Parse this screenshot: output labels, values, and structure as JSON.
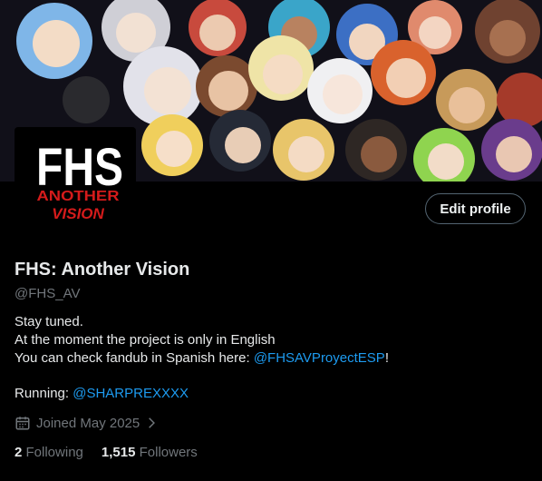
{
  "profile": {
    "avatar_text_main": "FHS",
    "avatar_text_sub1": "ANOTHER",
    "avatar_text_sub2": "VISION",
    "edit_button": "Edit profile",
    "display_name": "FHS: Another Vision",
    "handle": "@FHS_AV",
    "bio": {
      "line1": "Stay tuned.",
      "line2": "At the moment the project is only in English",
      "line3_prefix": "You can check fandub in Spanish here: ",
      "line3_link": "@FHSAVProyectESP",
      "line3_suffix": "!"
    },
    "running_label": "Running: ",
    "running_link": "@SHARPREXXXX",
    "joined": "Joined May 2025",
    "following_count": "2",
    "following_label": "Following",
    "followers_count": "1,515",
    "followers_label": "Followers"
  },
  "colors": {
    "background": "#000000",
    "link": "#1d9bf0",
    "muted": "#71767b",
    "text": "#e7e9ea",
    "avatar_red": "#d51b1b"
  },
  "icons": {
    "calendar": "calendar-icon",
    "chevron": "chevron-right-icon"
  }
}
